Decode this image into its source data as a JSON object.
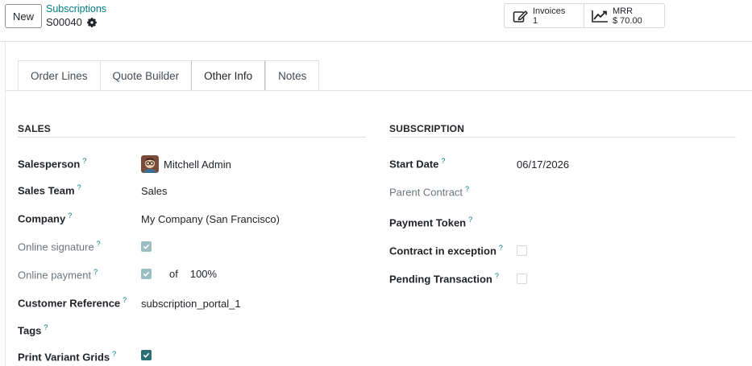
{
  "toolbar": {
    "new_label": "New",
    "breadcrumb": "Subscriptions",
    "record_name": "S00040"
  },
  "smart_buttons": {
    "invoices": {
      "label": "Invoices",
      "value": "1"
    },
    "mrr": {
      "label": "MRR",
      "value": "$ 70.00"
    }
  },
  "tabs": [
    "Order Lines",
    "Quote Builder",
    "Other Info",
    "Notes"
  ],
  "active_tab": "Other Info",
  "sales": {
    "title": "SALES",
    "salesperson_label": "Salesperson",
    "salesperson_value": "Mitchell Admin",
    "sales_team_label": "Sales Team",
    "sales_team_value": "Sales",
    "company_label": "Company",
    "company_value": "My Company (San Francisco)",
    "online_signature_label": "Online signature",
    "online_signature_checked": true,
    "online_payment_label": "Online payment",
    "online_payment_checked": true,
    "online_payment_of": "of",
    "online_payment_percent": "100%",
    "customer_reference_label": "Customer Reference",
    "customer_reference_value": "subscription_portal_1",
    "tags_label": "Tags",
    "print_variant_grids_label": "Print Variant Grids",
    "print_variant_grids_checked": true
  },
  "subscription": {
    "title": "SUBSCRIPTION",
    "start_date_label": "Start Date",
    "start_date_value": "06/17/2026",
    "parent_contract_label": "Parent Contract",
    "payment_token_label": "Payment Token",
    "contract_in_exception_label": "Contract in exception",
    "contract_in_exception_checked": false,
    "pending_transaction_label": "Pending Transaction",
    "pending_transaction_checked": false
  },
  "help_mark": "?",
  "colors": {
    "accent": "#017e84",
    "checkbox": "#2a6f75",
    "checkbox_readonly": "#9bbfc2",
    "muted_label": "#6c757d"
  },
  "icons": {
    "record_settings": "gear-icon",
    "invoices": "pencil-square-icon",
    "mrr": "trend-chart-icon",
    "avatar": "avatar"
  }
}
